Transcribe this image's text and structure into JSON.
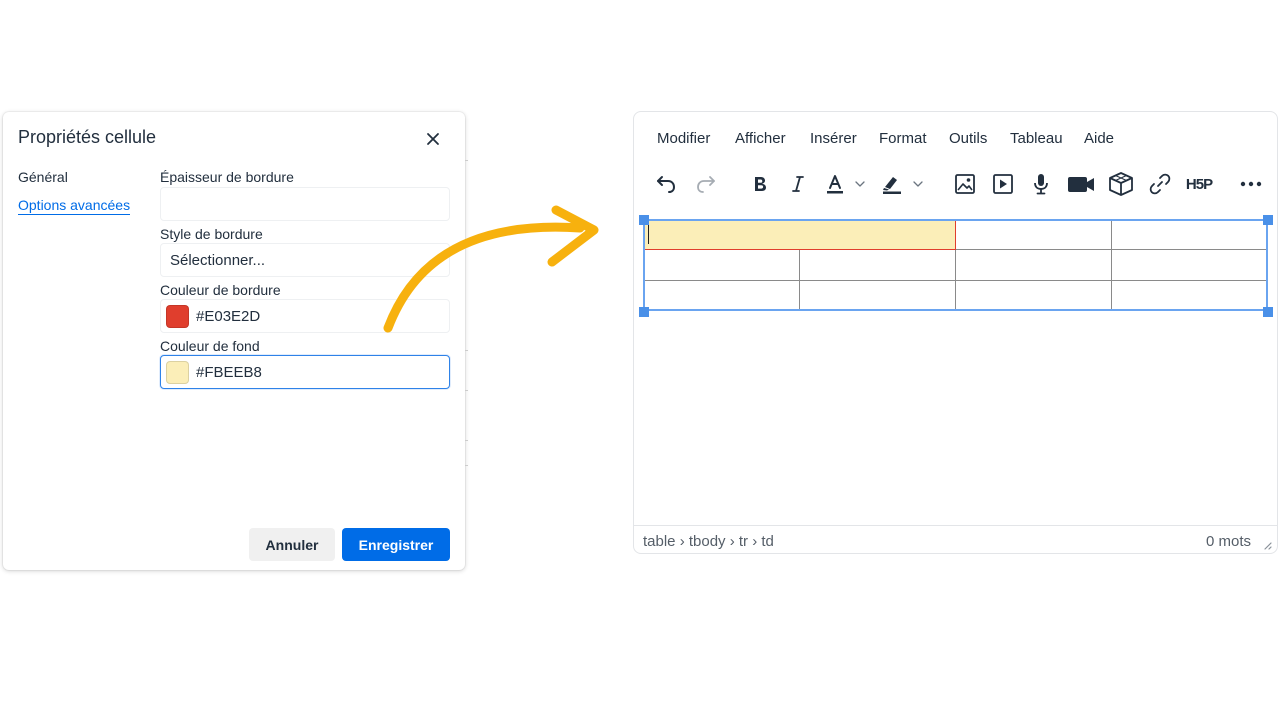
{
  "dialog": {
    "title": "Propriétés cellule",
    "tabs": [
      "Général",
      "Options avancées"
    ],
    "fields": {
      "border_width_label": "Épaisseur de bordure",
      "border_width_value": "",
      "border_style_label": "Style de bordure",
      "border_style_value": "Sélectionner...",
      "border_color_label": "Couleur de bordure",
      "border_color_value": "#E03E2D",
      "bg_color_label": "Couleur de fond",
      "bg_color_value": "#FBEEB8"
    },
    "buttons": {
      "cancel": "Annuler",
      "save": "Enregistrer"
    }
  },
  "editor": {
    "menu": [
      "Modifier",
      "Afficher",
      "Insérer",
      "Format",
      "Outils",
      "Tableau",
      "Aide"
    ],
    "toolbar": {
      "h5p_label": "H5P",
      "icons": [
        "undo-icon",
        "redo-icon",
        "bold-icon",
        "italic-icon",
        "text-color-icon",
        "highlight-icon",
        "image-icon",
        "media-icon",
        "microphone-icon",
        "video-camera-icon",
        "cube-icon",
        "link-icon",
        "more-icon"
      ]
    },
    "status": {
      "path": "table › tbody › tr › td",
      "words": "0 mots"
    }
  },
  "colors": {
    "accent": "#006ce7",
    "arrow": "#f7b10e",
    "border_color": "#E03E2D",
    "background_color": "#FBEEB8"
  }
}
